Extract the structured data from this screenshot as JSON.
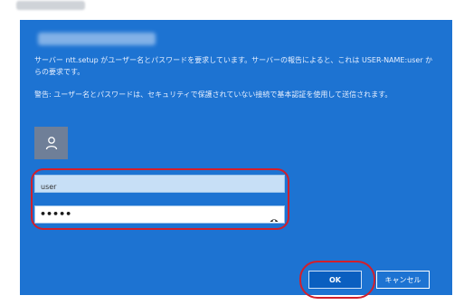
{
  "dialog": {
    "message1": "サーバー ntt.setup がユーザー名とパスワードを要求しています。サーバーの報告によると、これは USER-NAME:user からの要求です。",
    "message2": "警告: ユーザー名とパスワードは、セキュリティで保護されていない接続で基本認証を使用して送信されます。",
    "username_value": "user",
    "password_masked": "•••••",
    "ok_label": "OK",
    "cancel_label": "キャンセル"
  },
  "colors": {
    "dialog_bg": "#1d73d2",
    "highlight_ring": "#d21f2b"
  },
  "icons": {
    "avatar": "person-icon",
    "reveal": "eye-icon"
  }
}
